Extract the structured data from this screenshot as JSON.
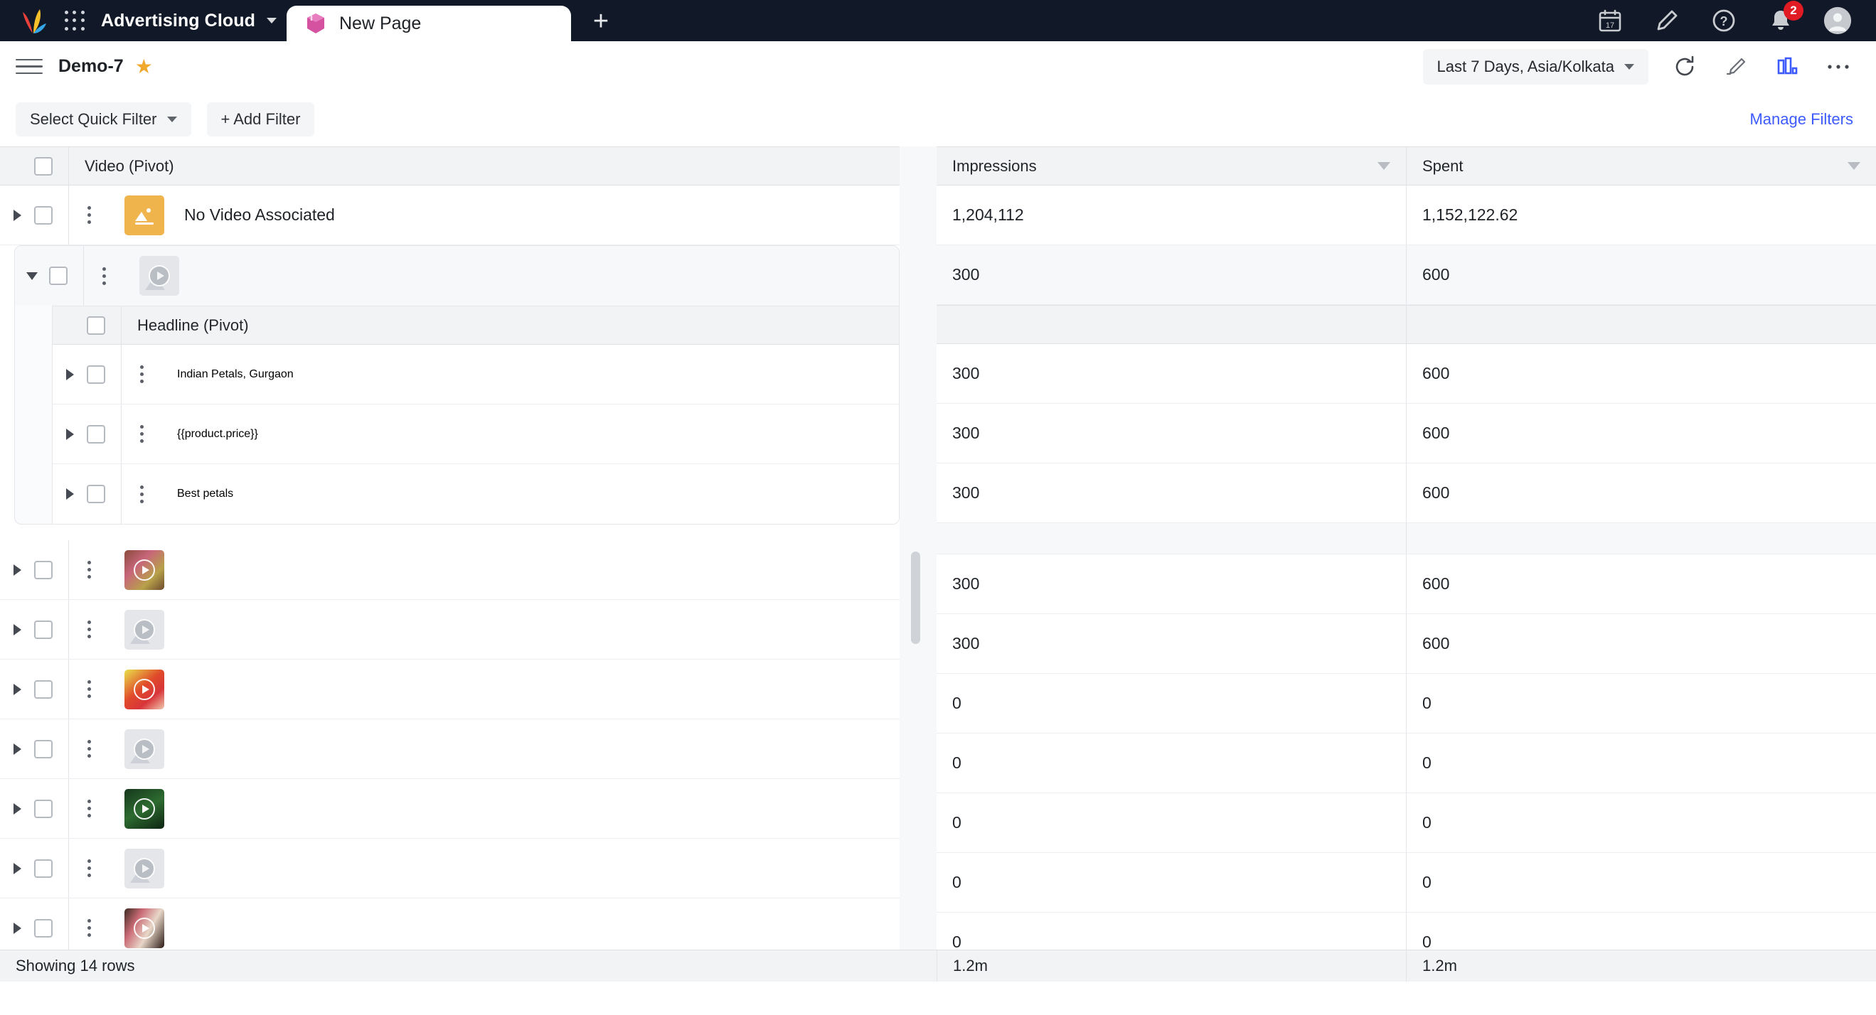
{
  "appbar": {
    "brand": "Advertising Cloud",
    "tab_title": "New Page",
    "newtab_label": "+",
    "notification_count": "2",
    "calendar_day": "17",
    "help_glyph": "?"
  },
  "toolbar": {
    "page_title": "Demo-7",
    "star_glyph": "★",
    "date_range": "Last 7 Days, Asia/Kolkata",
    "refresh_glyph": "⟳"
  },
  "filters": {
    "quick_filter": "Select Quick Filter",
    "add_filter": "+ Add Filter",
    "manage_filters": "Manage Filters"
  },
  "grid": {
    "columns": {
      "video": "Video (Pivot)",
      "headline": "Headline (Pivot)",
      "impressions": "Impressions",
      "spent": "Spent"
    },
    "rows": [
      {
        "label": "No Video Associated",
        "thumb": "no-video",
        "impressions": "1,204,112",
        "spent": "1,152,122.62"
      },
      {
        "label": "",
        "thumb": "placeholder",
        "impressions": "300",
        "spent": "600"
      }
    ],
    "subrows": [
      {
        "label": "Indian Petals, Gurgaon",
        "impressions": "300",
        "spent": "600"
      },
      {
        "label": "{{product.price}}",
        "impressions": "300",
        "spent": "600"
      },
      {
        "label": "Best petals",
        "impressions": "300",
        "spent": "600"
      }
    ],
    "tail_rows": [
      {
        "label": "",
        "thumb": "butterfly",
        "impressions": "300",
        "spent": "600"
      },
      {
        "label": "",
        "thumb": "placeholder",
        "impressions": "300",
        "spent": "600"
      },
      {
        "label": "",
        "thumb": "roses",
        "impressions": "0",
        "spent": "0"
      },
      {
        "label": "",
        "thumb": "placeholder",
        "impressions": "0",
        "spent": "0"
      },
      {
        "label": "",
        "thumb": "leaves",
        "impressions": "0",
        "spent": "0"
      },
      {
        "label": "",
        "thumb": "placeholder",
        "impressions": "0",
        "spent": "0"
      },
      {
        "label": "",
        "thumb": "bouquet",
        "impressions": "0",
        "spent": "0"
      }
    ],
    "footer": {
      "rows_label": "Showing 14 rows",
      "impressions_total": "1.2m",
      "spent_total": "1.2m"
    }
  },
  "colors": {
    "appbar_bg": "#111827",
    "accent_link": "#3d5afe",
    "star": "#f0a92e",
    "badge": "#e01b24",
    "placeholder_thumb": "#f0b44d",
    "chart_icon": "#3d5afe"
  }
}
